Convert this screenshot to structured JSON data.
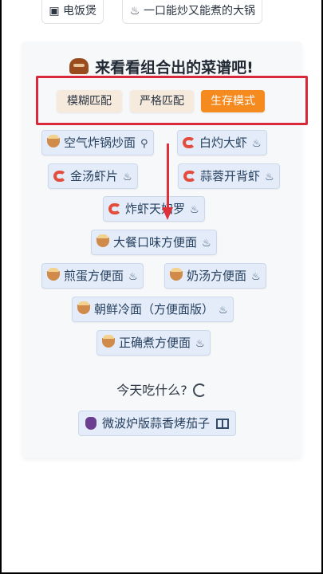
{
  "top_tools": [
    {
      "icon": "rice-cooker-icon",
      "label": "电饭煲"
    },
    {
      "icon": "wok-icon",
      "label": "一口能炒又能煮的大锅"
    }
  ],
  "section": {
    "title": "来看看组合出的菜谱吧!",
    "title_icon": "chef-hat-icon"
  },
  "modes": [
    {
      "label": "模糊匹配",
      "active": false
    },
    {
      "label": "严格匹配",
      "active": false
    },
    {
      "label": "生存模式",
      "active": true
    }
  ],
  "recipes": [
    {
      "name": "空气炸锅炒面",
      "icon": "noodle-bowl-icon",
      "tool_icon": "pin-icon"
    },
    {
      "name": "白灼大虾",
      "icon": "shrimp-icon",
      "tool_icon": "pot-icon"
    },
    {
      "name": "金汤虾片",
      "icon": "shrimp-icon",
      "tool_icon": "pot-icon"
    },
    {
      "name": "蒜蓉开背虾",
      "icon": "shrimp-icon",
      "tool_icon": "pot-icon"
    },
    {
      "name": "炸虾天妇罗",
      "icon": "shrimp-icon",
      "tool_icon": "pot-icon"
    },
    {
      "name": "大餐口味方便面",
      "icon": "noodle-bowl-icon",
      "tool_icon": "pot-icon"
    },
    {
      "name": "煎蛋方便面",
      "icon": "noodle-bowl-icon",
      "tool_icon": "pot-icon"
    },
    {
      "name": "奶汤方便面",
      "icon": "noodle-bowl-icon",
      "tool_icon": "pot-icon"
    },
    {
      "name": "朝鲜冷面（方便面版）",
      "icon": "noodle-bowl-icon",
      "tool_icon": "pot-icon"
    },
    {
      "name": "正确煮方便面",
      "icon": "noodle-bowl-icon",
      "tool_icon": "pot-icon"
    }
  ],
  "today": {
    "label": "今天吃什么?",
    "icon": "refresh-icon"
  },
  "suggestion": {
    "name": "微波炉版蒜香烤茄子",
    "icon": "eggplant-icon",
    "tool_icon": "microwave-icon"
  },
  "colors": {
    "accent": "#f58a1f",
    "chip_bg": "#e3ecf8",
    "highlight": "#d9283a",
    "arrow": "#e0303a"
  }
}
